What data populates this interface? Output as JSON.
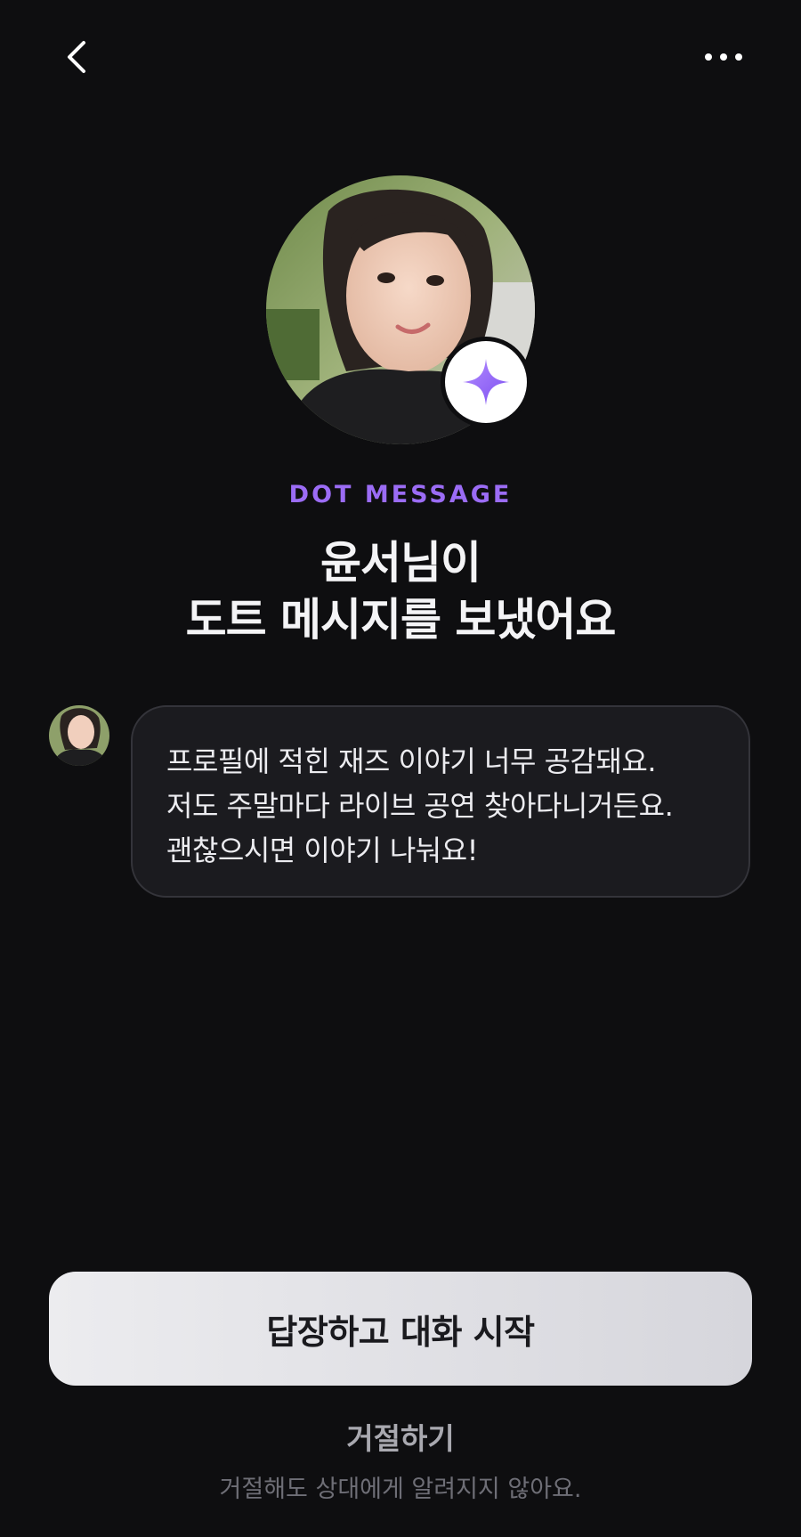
{
  "header": {
    "back_icon": "chevron-left-icon",
    "more_icon": "more-horizontal-icon"
  },
  "profile": {
    "avatar_alt": "profile photo",
    "badge_icon": "sparkle-icon",
    "accent_color": "#9b6cf5"
  },
  "intro": {
    "eyebrow": "DOT MESSAGE",
    "headline_line1": "윤서님이",
    "headline_line2": "도트 메시지를 보냈어요"
  },
  "message": {
    "lines": [
      "프로필에 적힌 재즈 이야기 너무 공감돼요.",
      "저도 주말마다 라이브 공연 찾아다니거든요.",
      "괜찮으시면 이야기 나눠요!"
    ]
  },
  "actions": {
    "reply_label": "답장하고 대화 시작",
    "decline_label": "거절하기",
    "decline_note": "거절해도 상대에게 알려지지 않아요."
  }
}
